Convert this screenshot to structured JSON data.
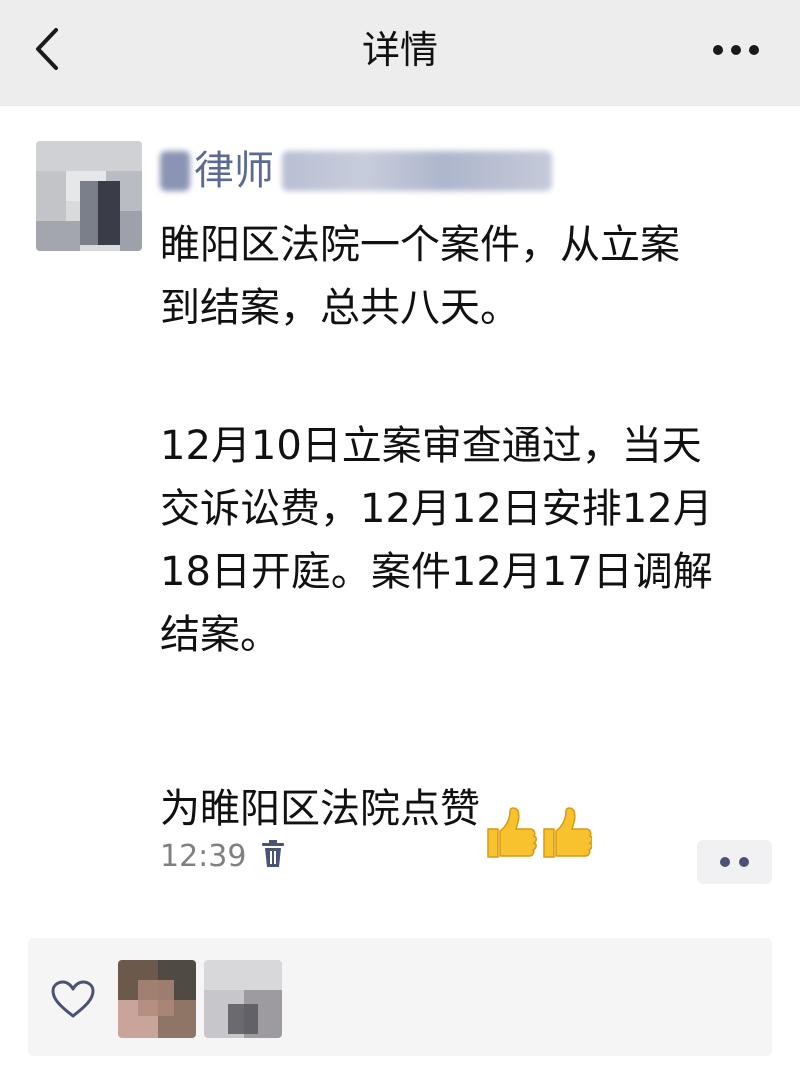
{
  "header": {
    "title": "详情",
    "back_icon": "chevron-left-icon",
    "more_icon": "more-horizontal-icon"
  },
  "post": {
    "author_name": "律师",
    "paragraphs": [
      "睢阳区法院一个案件，从立案\n到结案，总共八天。",
      "12月10日立案审查通过，当天\n交诉讼费，12月12日安排12月\n18日开庭。案件12月17日调解\n结案。",
      "为睢阳区法院点赞"
    ],
    "emoji": "👍👍",
    "time": "12:39",
    "delete_icon": "trash-icon",
    "comment_icon": "comment-dots-icon"
  },
  "likes": {
    "icon": "heart-outline-icon"
  },
  "colors": {
    "header_bg": "#ededed",
    "author_name": "#5b6a91",
    "time": "#808080",
    "icon": "#4a5373",
    "panel_bg": "#f5f5f5"
  }
}
